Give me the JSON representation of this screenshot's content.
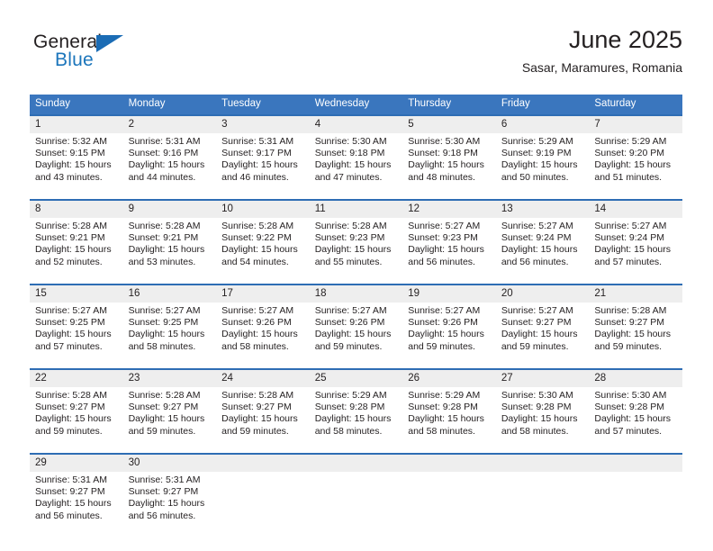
{
  "brand": {
    "name_top": "General",
    "name_bottom": "Blue",
    "triangle_icon": "triangle-logo-icon",
    "accent_color": "#1b75bb"
  },
  "header": {
    "title": "June 2025",
    "location": "Sasar, Maramures, Romania"
  },
  "theme": {
    "header_blue": "#3a76be",
    "rule_blue": "#2e6db4",
    "daynum_band": "#eeeeee"
  },
  "weekdays": [
    "Sunday",
    "Monday",
    "Tuesday",
    "Wednesday",
    "Thursday",
    "Friday",
    "Saturday"
  ],
  "weeks": [
    [
      {
        "day": "1",
        "sunrise": "Sunrise: 5:32 AM",
        "sunset": "Sunset: 9:15 PM",
        "daylight1": "Daylight: 15 hours",
        "daylight2": "and 43 minutes."
      },
      {
        "day": "2",
        "sunrise": "Sunrise: 5:31 AM",
        "sunset": "Sunset: 9:16 PM",
        "daylight1": "Daylight: 15 hours",
        "daylight2": "and 44 minutes."
      },
      {
        "day": "3",
        "sunrise": "Sunrise: 5:31 AM",
        "sunset": "Sunset: 9:17 PM",
        "daylight1": "Daylight: 15 hours",
        "daylight2": "and 46 minutes."
      },
      {
        "day": "4",
        "sunrise": "Sunrise: 5:30 AM",
        "sunset": "Sunset: 9:18 PM",
        "daylight1": "Daylight: 15 hours",
        "daylight2": "and 47 minutes."
      },
      {
        "day": "5",
        "sunrise": "Sunrise: 5:30 AM",
        "sunset": "Sunset: 9:18 PM",
        "daylight1": "Daylight: 15 hours",
        "daylight2": "and 48 minutes."
      },
      {
        "day": "6",
        "sunrise": "Sunrise: 5:29 AM",
        "sunset": "Sunset: 9:19 PM",
        "daylight1": "Daylight: 15 hours",
        "daylight2": "and 50 minutes."
      },
      {
        "day": "7",
        "sunrise": "Sunrise: 5:29 AM",
        "sunset": "Sunset: 9:20 PM",
        "daylight1": "Daylight: 15 hours",
        "daylight2": "and 51 minutes."
      }
    ],
    [
      {
        "day": "8",
        "sunrise": "Sunrise: 5:28 AM",
        "sunset": "Sunset: 9:21 PM",
        "daylight1": "Daylight: 15 hours",
        "daylight2": "and 52 minutes."
      },
      {
        "day": "9",
        "sunrise": "Sunrise: 5:28 AM",
        "sunset": "Sunset: 9:21 PM",
        "daylight1": "Daylight: 15 hours",
        "daylight2": "and 53 minutes."
      },
      {
        "day": "10",
        "sunrise": "Sunrise: 5:28 AM",
        "sunset": "Sunset: 9:22 PM",
        "daylight1": "Daylight: 15 hours",
        "daylight2": "and 54 minutes."
      },
      {
        "day": "11",
        "sunrise": "Sunrise: 5:28 AM",
        "sunset": "Sunset: 9:23 PM",
        "daylight1": "Daylight: 15 hours",
        "daylight2": "and 55 minutes."
      },
      {
        "day": "12",
        "sunrise": "Sunrise: 5:27 AM",
        "sunset": "Sunset: 9:23 PM",
        "daylight1": "Daylight: 15 hours",
        "daylight2": "and 56 minutes."
      },
      {
        "day": "13",
        "sunrise": "Sunrise: 5:27 AM",
        "sunset": "Sunset: 9:24 PM",
        "daylight1": "Daylight: 15 hours",
        "daylight2": "and 56 minutes."
      },
      {
        "day": "14",
        "sunrise": "Sunrise: 5:27 AM",
        "sunset": "Sunset: 9:24 PM",
        "daylight1": "Daylight: 15 hours",
        "daylight2": "and 57 minutes."
      }
    ],
    [
      {
        "day": "15",
        "sunrise": "Sunrise: 5:27 AM",
        "sunset": "Sunset: 9:25 PM",
        "daylight1": "Daylight: 15 hours",
        "daylight2": "and 57 minutes."
      },
      {
        "day": "16",
        "sunrise": "Sunrise: 5:27 AM",
        "sunset": "Sunset: 9:25 PM",
        "daylight1": "Daylight: 15 hours",
        "daylight2": "and 58 minutes."
      },
      {
        "day": "17",
        "sunrise": "Sunrise: 5:27 AM",
        "sunset": "Sunset: 9:26 PM",
        "daylight1": "Daylight: 15 hours",
        "daylight2": "and 58 minutes."
      },
      {
        "day": "18",
        "sunrise": "Sunrise: 5:27 AM",
        "sunset": "Sunset: 9:26 PM",
        "daylight1": "Daylight: 15 hours",
        "daylight2": "and 59 minutes."
      },
      {
        "day": "19",
        "sunrise": "Sunrise: 5:27 AM",
        "sunset": "Sunset: 9:26 PM",
        "daylight1": "Daylight: 15 hours",
        "daylight2": "and 59 minutes."
      },
      {
        "day": "20",
        "sunrise": "Sunrise: 5:27 AM",
        "sunset": "Sunset: 9:27 PM",
        "daylight1": "Daylight: 15 hours",
        "daylight2": "and 59 minutes."
      },
      {
        "day": "21",
        "sunrise": "Sunrise: 5:28 AM",
        "sunset": "Sunset: 9:27 PM",
        "daylight1": "Daylight: 15 hours",
        "daylight2": "and 59 minutes."
      }
    ],
    [
      {
        "day": "22",
        "sunrise": "Sunrise: 5:28 AM",
        "sunset": "Sunset: 9:27 PM",
        "daylight1": "Daylight: 15 hours",
        "daylight2": "and 59 minutes."
      },
      {
        "day": "23",
        "sunrise": "Sunrise: 5:28 AM",
        "sunset": "Sunset: 9:27 PM",
        "daylight1": "Daylight: 15 hours",
        "daylight2": "and 59 minutes."
      },
      {
        "day": "24",
        "sunrise": "Sunrise: 5:28 AM",
        "sunset": "Sunset: 9:27 PM",
        "daylight1": "Daylight: 15 hours",
        "daylight2": "and 59 minutes."
      },
      {
        "day": "25",
        "sunrise": "Sunrise: 5:29 AM",
        "sunset": "Sunset: 9:28 PM",
        "daylight1": "Daylight: 15 hours",
        "daylight2": "and 58 minutes."
      },
      {
        "day": "26",
        "sunrise": "Sunrise: 5:29 AM",
        "sunset": "Sunset: 9:28 PM",
        "daylight1": "Daylight: 15 hours",
        "daylight2": "and 58 minutes."
      },
      {
        "day": "27",
        "sunrise": "Sunrise: 5:30 AM",
        "sunset": "Sunset: 9:28 PM",
        "daylight1": "Daylight: 15 hours",
        "daylight2": "and 58 minutes."
      },
      {
        "day": "28",
        "sunrise": "Sunrise: 5:30 AM",
        "sunset": "Sunset: 9:28 PM",
        "daylight1": "Daylight: 15 hours",
        "daylight2": "and 57 minutes."
      }
    ],
    [
      {
        "day": "29",
        "sunrise": "Sunrise: 5:31 AM",
        "sunset": "Sunset: 9:27 PM",
        "daylight1": "Daylight: 15 hours",
        "daylight2": "and 56 minutes."
      },
      {
        "day": "30",
        "sunrise": "Sunrise: 5:31 AM",
        "sunset": "Sunset: 9:27 PM",
        "daylight1": "Daylight: 15 hours",
        "daylight2": "and 56 minutes."
      },
      {
        "day": "",
        "sunrise": "",
        "sunset": "",
        "daylight1": "",
        "daylight2": ""
      },
      {
        "day": "",
        "sunrise": "",
        "sunset": "",
        "daylight1": "",
        "daylight2": ""
      },
      {
        "day": "",
        "sunrise": "",
        "sunset": "",
        "daylight1": "",
        "daylight2": ""
      },
      {
        "day": "",
        "sunrise": "",
        "sunset": "",
        "daylight1": "",
        "daylight2": ""
      },
      {
        "day": "",
        "sunrise": "",
        "sunset": "",
        "daylight1": "",
        "daylight2": ""
      }
    ]
  ]
}
